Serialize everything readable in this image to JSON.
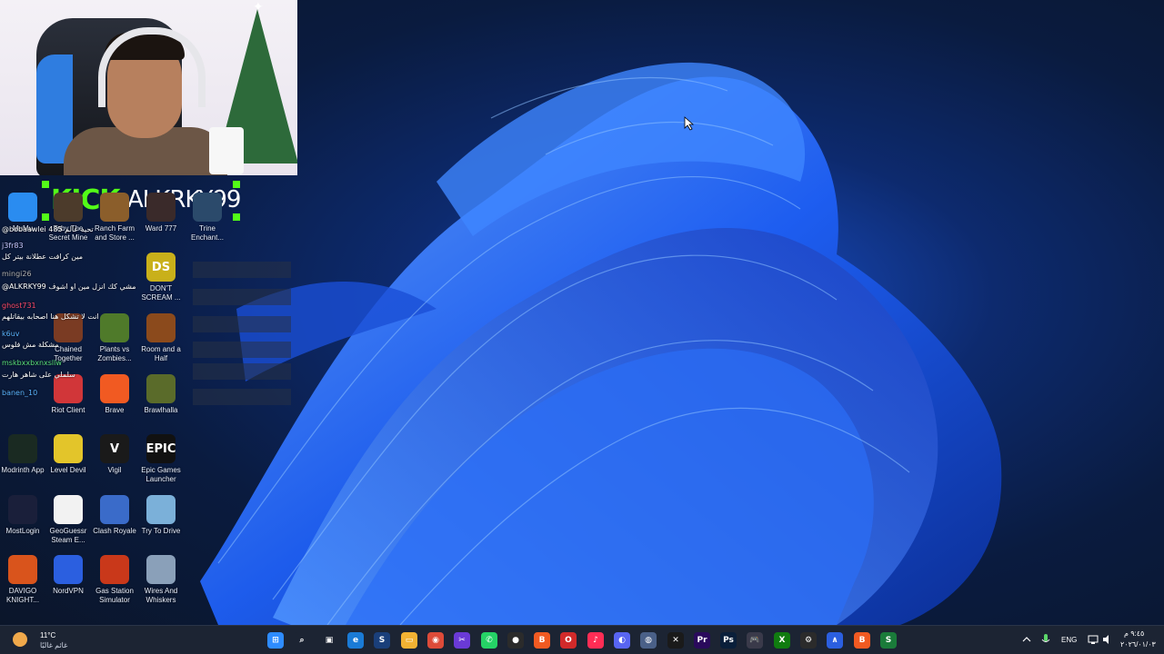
{
  "stream_overlay": {
    "platform_tag": "KICK",
    "channel_name": "ALKRKY99"
  },
  "desktop_icons": [
    {
      "label": "MuMu",
      "color": "#2a8cf0",
      "glyph": "",
      "icon": "mumu-icon"
    },
    {
      "label": "Toby The Secret Mine",
      "color": "#4c3b2b",
      "glyph": "",
      "icon": "toby-icon"
    },
    {
      "label": "Ranch Farm and Store ...",
      "color": "#8b5e2b",
      "glyph": "",
      "icon": "ranch-farm-icon"
    },
    {
      "label": "Ward 777",
      "color": "#3a2a2a",
      "glyph": "",
      "icon": "ward-777-icon"
    },
    {
      "label": "Trine Enchant...",
      "color": "#2b4a6b",
      "glyph": "",
      "icon": "trine-icon"
    },
    {
      "label": "Chained Together",
      "color": "#7a3b23",
      "glyph": "",
      "icon": "chained-together-icon"
    },
    {
      "label": "Plants vs Zombies...",
      "color": "#4f7a2a",
      "glyph": "",
      "icon": "pvz-icon"
    },
    {
      "label": "Room and a Half",
      "color": "#8b4a1c",
      "glyph": "",
      "icon": "room-and-half-icon"
    },
    {
      "label": "Riot Client",
      "color": "#d13639",
      "glyph": "",
      "icon": "riot-client-icon"
    },
    {
      "label": "Brave",
      "color": "#f15a22",
      "glyph": "",
      "icon": "brave-icon"
    },
    {
      "label": "Brawlhalla",
      "color": "#5a6b2a",
      "glyph": "",
      "icon": "brawlhalla-icon"
    },
    {
      "label": "Modrinth App",
      "color": "#1a2a22",
      "glyph": "",
      "icon": "modrinth-icon"
    },
    {
      "label": "Level Devil",
      "color": "#e3c52a",
      "glyph": "",
      "icon": "level-devil-icon"
    },
    {
      "label": "Vigil",
      "color": "#1a1a1a",
      "glyph": "V",
      "icon": "vigil-icon"
    },
    {
      "label": "Epic Games Launcher",
      "color": "#111111",
      "glyph": "EPIC",
      "icon": "epic-games-icon"
    },
    {
      "label": "MostLogin",
      "color": "#1a1f3a",
      "glyph": "",
      "icon": "mostlogin-icon"
    },
    {
      "label": "GeoGuessr Steam E...",
      "color": "#f2f2f2",
      "glyph": "",
      "icon": "geoguessr-icon"
    },
    {
      "label": "Clash Royale",
      "color": "#3a6bc9",
      "glyph": "",
      "icon": "clash-royale-icon"
    },
    {
      "label": "Try To Drive",
      "color": "#7bb0d9",
      "glyph": "",
      "icon": "try-to-drive-icon"
    },
    {
      "label": "DAVIGO KNIGHT...",
      "color": "#d9541c",
      "glyph": "",
      "icon": "davigo-icon"
    },
    {
      "label": "NordVPN",
      "color": "#2b5fe0",
      "glyph": "",
      "icon": "nordvpn-icon"
    },
    {
      "label": "Gas Station Simulator",
      "color": "#c9381a",
      "glyph": "",
      "icon": "gas-station-icon"
    },
    {
      "label": "Wires And Whiskers",
      "color": "#8aa0b9",
      "glyph": "",
      "icon": "wires-whiskers-icon"
    },
    {
      "label": "DON'T SCREAM ...",
      "color": "#c9b01a",
      "glyph": "DS",
      "icon": "dont-scream-icon"
    }
  ],
  "chat": [
    {
      "text": "@bobaawlei 485 تحيه عالم",
      "color": "#ffffff"
    },
    {
      "text": "j3fr83",
      "color": "#c9c9ff"
    },
    {
      "text": "مين كرافت عطلانة بيتر كل",
      "color": "#ffffff"
    },
    {
      "text": "mingi26",
      "color": "#b0b0b0"
    },
    {
      "text": "@ALKRKY99 مشي كك انزل مين او اشوف",
      "color": "#ffffff"
    },
    {
      "text": "ghost731",
      "color": "#ff4a6a"
    },
    {
      "text": "انت لا تشكل هنا اصحابه بيقاتلهم",
      "color": "#ffffff"
    },
    {
      "text": "k6uv",
      "color": "#5ab4ff"
    },
    {
      "text": "مشكلة مش فلوس",
      "color": "#ffffff"
    },
    {
      "text": "mskbxxbxnxsllw",
      "color": "#59e07a"
    },
    {
      "text": "banen_10",
      "color": "#5ab4ff"
    },
    {
      "text": "سلملي على شاهر هارت",
      "color": "#ffffff"
    }
  ],
  "taskbar": {
    "weather_temp": "11°C",
    "weather_condition": "غائم غالبًا",
    "language": "ENG",
    "time": "٩:٤٥ م",
    "date": "٢٠٢٦/٠١/٠٣",
    "apps": [
      "start-icon",
      "search-icon",
      "task-view-icon",
      "edge-icon",
      "steam-icon",
      "file-explorer-icon",
      "chrome-icon",
      "snipping-icon",
      "whatsapp-icon",
      "obs-icon",
      "brave-icon",
      "opera-icon",
      "tiktok-icon",
      "discord-icon",
      "settings-alt-icon",
      "capcut-icon",
      "premiere-icon",
      "photoshop-icon",
      "controller-icon",
      "xbox-icon",
      "gear-icon",
      "nordvpn-icon",
      "brave-taskbar-icon",
      "steam-green-icon"
    ]
  }
}
